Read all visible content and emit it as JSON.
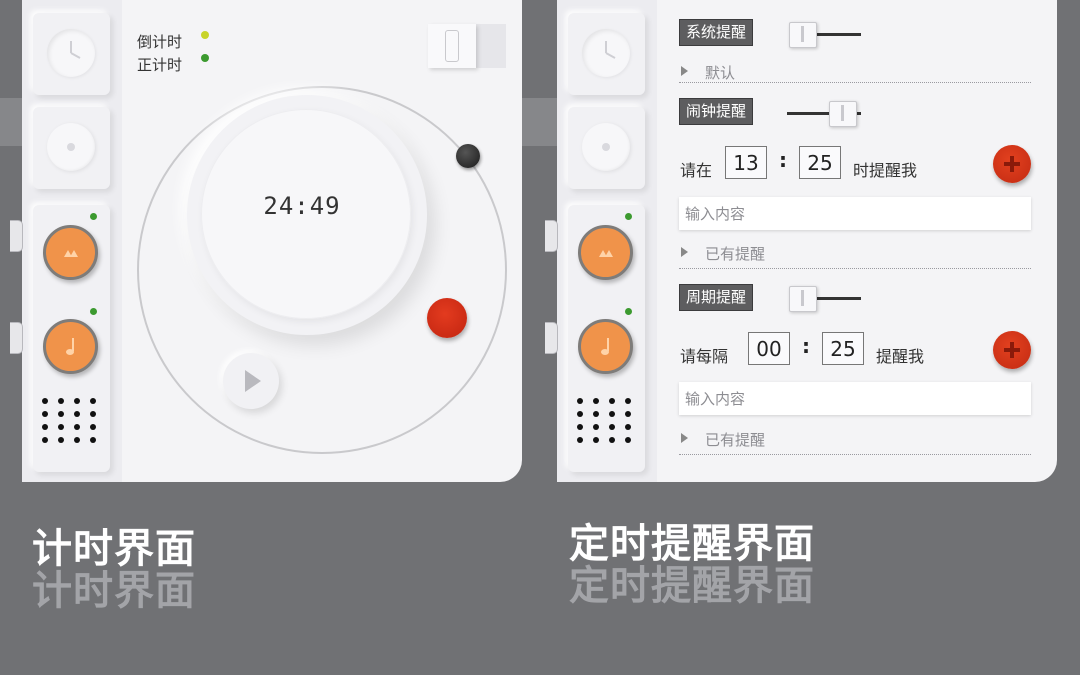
{
  "timer_panel": {
    "mode_countdown": "倒计时",
    "mode_countup": "正计时",
    "time_display": "24:49",
    "caption": "计时界面"
  },
  "reminder_panel": {
    "system": {
      "label": "系统提醒",
      "option": "默认"
    },
    "alarm": {
      "label": "闹钟提醒",
      "prefix": "请在",
      "hour": "13",
      "colon": ":",
      "minute": "25",
      "suffix": "时提醒我",
      "input_placeholder": "输入内容",
      "existing": "已有提醒"
    },
    "periodic": {
      "label": "周期提醒",
      "prefix": "请每隔",
      "hour": "00",
      "colon": ":",
      "minute": "25",
      "suffix": "提醒我",
      "input_placeholder": "输入内容",
      "existing": "已有提醒"
    },
    "caption": "定时提醒界面"
  },
  "colors": {
    "background": "#707174",
    "panel": "#f4f4f6",
    "accent_orange": "#f0934a",
    "accent_red": "#d4311a",
    "led_green": "#3c9a2f",
    "led_yellow": "#c8d42a"
  },
  "icons": [
    "clock-icon",
    "record-icon",
    "hourglass-icon",
    "music-note-icon",
    "speaker-grille-icon",
    "play-icon",
    "plus-icon",
    "triangle-right-icon"
  ]
}
